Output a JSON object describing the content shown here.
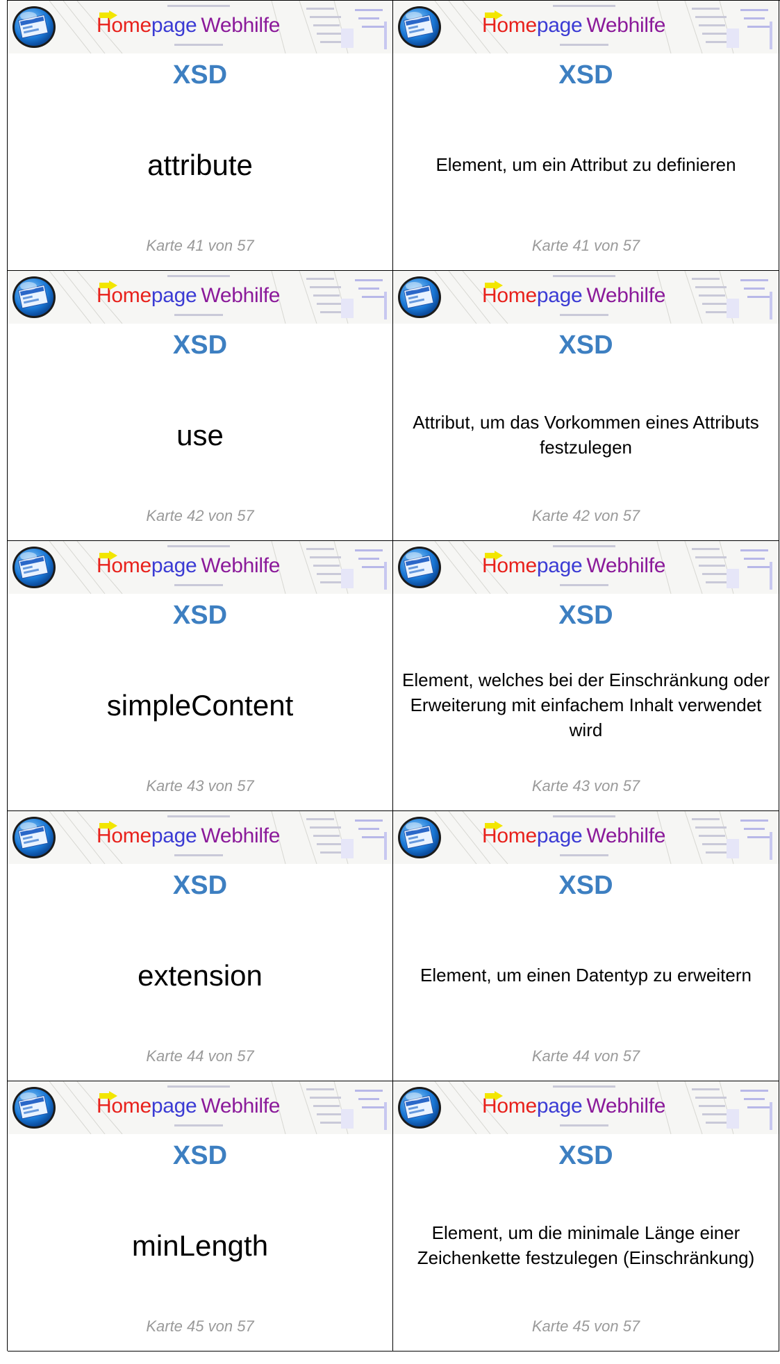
{
  "brand": {
    "home": "Home",
    "page": "page",
    "web": "Webhilfe"
  },
  "colors": {
    "home": "#e8211c",
    "page": "#3b3bd4",
    "web": "#8b1a9a",
    "subject": "#3d7fc1",
    "counter": "#9a9a9a",
    "arrow": "#f2e600"
  },
  "cards": [
    {
      "subject": "XSD",
      "term": "attribute",
      "definition": "Element, um ein Attribut zu definieren",
      "counter": "Karte 41 von 57"
    },
    {
      "subject": "XSD",
      "term": "use",
      "definition": "Attribut, um das Vorkommen eines Attributs festzulegen",
      "counter": "Karte 42 von 57"
    },
    {
      "subject": "XSD",
      "term": "simpleContent",
      "definition": "Element, welches bei der Einschränkung oder Erweiterung mit einfachem Inhalt verwendet wird",
      "counter": "Karte 43 von 57"
    },
    {
      "subject": "XSD",
      "term": "extension",
      "definition": "Element, um einen Datentyp zu erweitern",
      "counter": "Karte 44 von 57"
    },
    {
      "subject": "XSD",
      "term": "minLength",
      "definition": "Element, um die minimale Länge einer Zeichenkette festzulegen (Einschränkung)",
      "counter": "Karte 45 von 57"
    }
  ]
}
